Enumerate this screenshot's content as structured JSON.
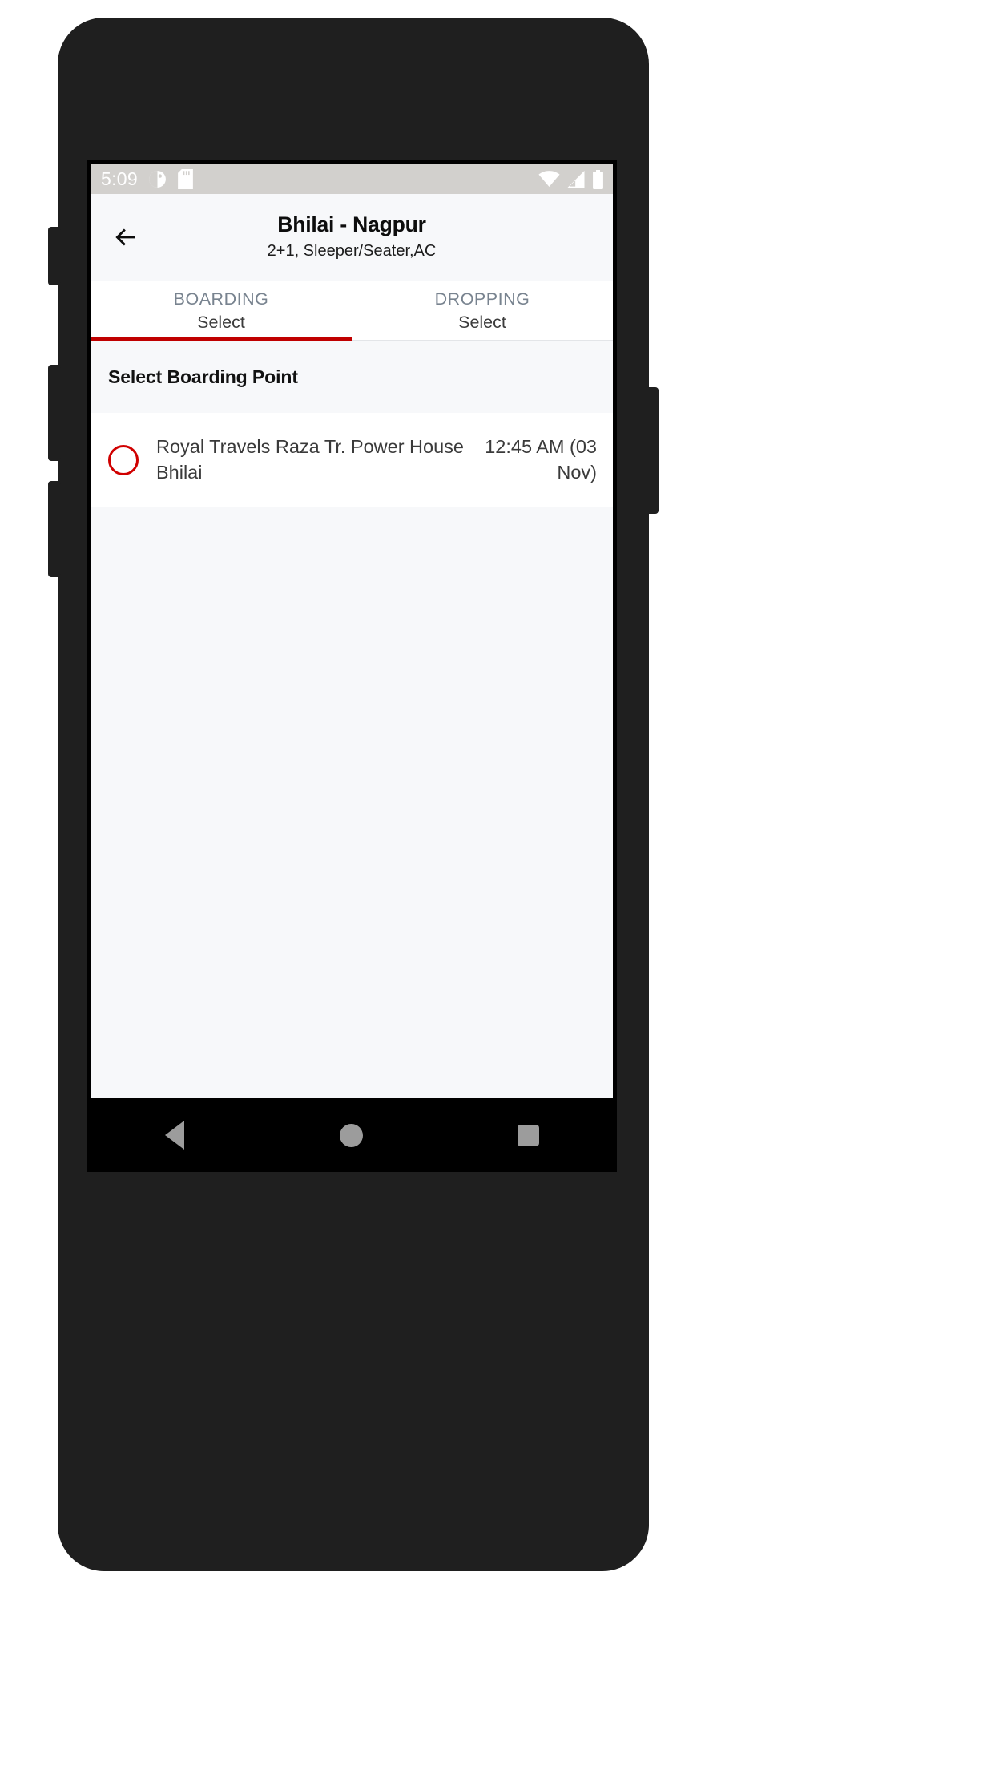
{
  "status_bar": {
    "time": "5:09",
    "left_icons": [
      "do-not-disturb-icon",
      "sd-card-icon"
    ],
    "right_icons": [
      "wifi-icon",
      "cellular-signal-icon",
      "battery-icon"
    ]
  },
  "app_bar": {
    "back_icon": "back-arrow-icon",
    "title": "Bhilai - Nagpur",
    "subtitle": "2+1, Sleeper/Seater,AC"
  },
  "tabs": {
    "active_index": 0,
    "indicator_color": "#c00000",
    "items": [
      {
        "caption": "BOARDING",
        "value": "Select"
      },
      {
        "caption": "DROPPING",
        "value": "Select"
      }
    ]
  },
  "section": {
    "title": "Select Boarding Point"
  },
  "boarding_points": [
    {
      "name": "Royal Travels Raza Tr. Power House Bhilai",
      "time": "12:45 AM (03 Nov)",
      "selected": false,
      "radio_color": "#d00000"
    }
  ],
  "nav_bar": {
    "back_label": "back-triangle-icon",
    "home_label": "home-circle-icon",
    "recents_label": "recents-square-icon"
  }
}
